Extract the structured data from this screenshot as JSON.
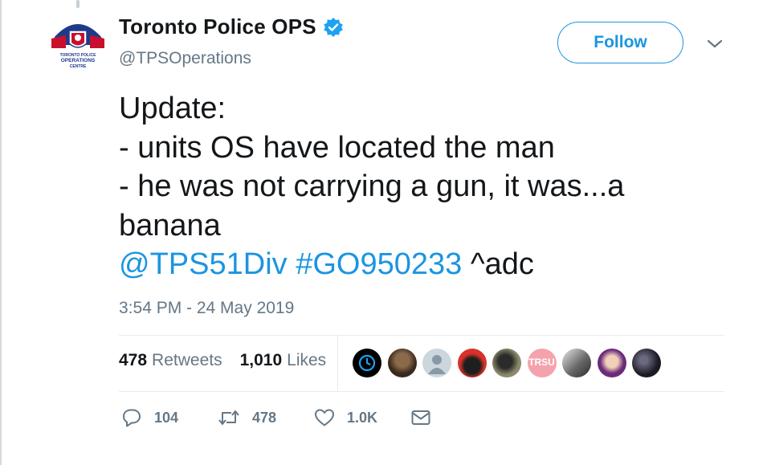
{
  "author": {
    "name": "Toronto Police OPS",
    "handle": "@TPSOperations",
    "avatar_text": "TORONTO POLICE OPERATIONS CENTRE",
    "verified": true
  },
  "follow_label": "Follow",
  "tweet": {
    "lines": [
      "Update:",
      "- units OS have located the man",
      "- he was not carrying a gun, it was...a",
      "banana"
    ],
    "mention": "@TPS51Div",
    "hashtag": "#GO950233",
    "signature": " ^adc"
  },
  "timestamp": "3:54 PM - 24 May 2019",
  "stats": {
    "retweets_count": "478",
    "retweets_label": "Retweets",
    "likes_count": "1,010",
    "likes_label": "Likes"
  },
  "likers": [
    {
      "icon": "circle-arrow-logo",
      "color": "#000000"
    },
    {
      "icon": "person-photo",
      "color": "#6b4a32"
    },
    {
      "icon": "default-avatar",
      "color": "#b7c0c7"
    },
    {
      "icon": "group-photo",
      "color": "#c0392b"
    },
    {
      "icon": "person-photo",
      "color": "#5a5440"
    },
    {
      "icon": "trsu-logo",
      "color": "#f4a3ad",
      "text": "TRSU"
    },
    {
      "icon": "bw-photo",
      "color": "#9a9a9a"
    },
    {
      "icon": "person-photo",
      "color": "#6a2b7a"
    },
    {
      "icon": "dark-photo",
      "color": "#2a2a3a"
    }
  ],
  "actions": {
    "reply_count": "104",
    "retweet_count": "478",
    "like_count": "1.0K"
  },
  "colors": {
    "accent": "#1b95e0",
    "secondary_text": "#657786",
    "primary_text": "#14171a"
  }
}
